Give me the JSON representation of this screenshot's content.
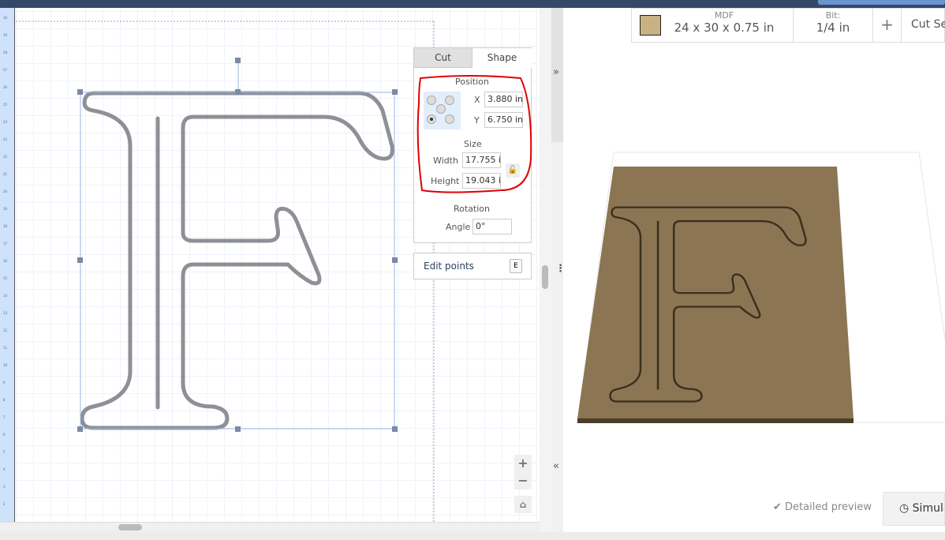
{
  "ruler": {
    "labels": [
      "30",
      "29",
      "28",
      "27",
      "26",
      "25",
      "24",
      "23",
      "22",
      "21",
      "20",
      "19",
      "18",
      "17",
      "16",
      "15",
      "14",
      "13",
      "12",
      "11",
      "10",
      "9",
      "8",
      "7",
      "6",
      "5",
      "4",
      "3",
      "2"
    ]
  },
  "panel": {
    "tabs": [
      {
        "label": "Cut",
        "active": false
      },
      {
        "label": "Shape",
        "active": true
      }
    ],
    "position": {
      "title": "Position",
      "x_label": "X",
      "x_value": "3.880 in",
      "y_label": "Y",
      "y_value": "6.750 in",
      "anchor_selected": "bottom-left"
    },
    "size": {
      "title": "Size",
      "width_label": "Width",
      "width_value": "17.755 i",
      "height_label": "Height",
      "height_value": "19.043 i",
      "lock_icon": "unlock-icon"
    },
    "rotation": {
      "title": "Rotation",
      "angle_label": "Angle",
      "angle_value": "0°"
    }
  },
  "edit_points": {
    "label": "Edit points",
    "shortcut": "E"
  },
  "zoom": {
    "in": "+",
    "out": "−",
    "home_icon": "home-icon"
  },
  "toolbar": {
    "material_name": "MDF",
    "material_dims": "24 x 30 x 0.75 in",
    "material_color": "#c8b283",
    "bit_label": "Bit:",
    "bit_value": "1/4 in",
    "add": "+",
    "cut_settings": "Cut Settin"
  },
  "preview": {
    "detailed": "Detailed preview",
    "simulate": "Simula",
    "board_color": "#8c7552"
  },
  "annotation_color": "#e00000"
}
